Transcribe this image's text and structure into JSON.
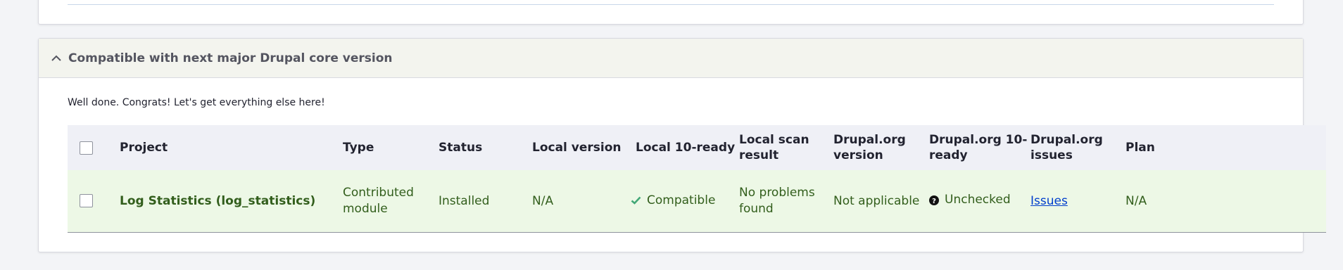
{
  "section": {
    "title": "Compatible with next major Drupal core version",
    "description": "Well done. Congrats! Let's get everything else here!"
  },
  "table": {
    "headers": {
      "project": "Project",
      "type": "Type",
      "status": "Status",
      "local_version": "Local version",
      "local_ready": "Local 10-ready",
      "local_scan": "Local scan result",
      "drupal_version": "Drupal.org version",
      "drupal_ready": "Drupal.org 10-ready",
      "drupal_issues": "Drupal.org issues",
      "plan": "Plan"
    },
    "rows": [
      {
        "project": "Log Statistics (log_statistics)",
        "type": "Contributed module",
        "status": "Installed",
        "local_version": "N/A",
        "local_ready": "Compatible",
        "local_scan": "No problems found",
        "drupal_version": "Not applicable",
        "drupal_ready": "Unchecked",
        "drupal_issues": "Issues",
        "plan": "N/A"
      }
    ]
  },
  "colors": {
    "row_success_bg": "#edf8e6",
    "row_success_text": "#325e1c",
    "header_bg": "#eff0f6",
    "link": "#003ecc",
    "check_icon": "#42a877"
  },
  "icons": {
    "collapse": "chevron-up-icon",
    "compatible": "checkmark-icon",
    "unchecked": "question-circle-icon"
  }
}
